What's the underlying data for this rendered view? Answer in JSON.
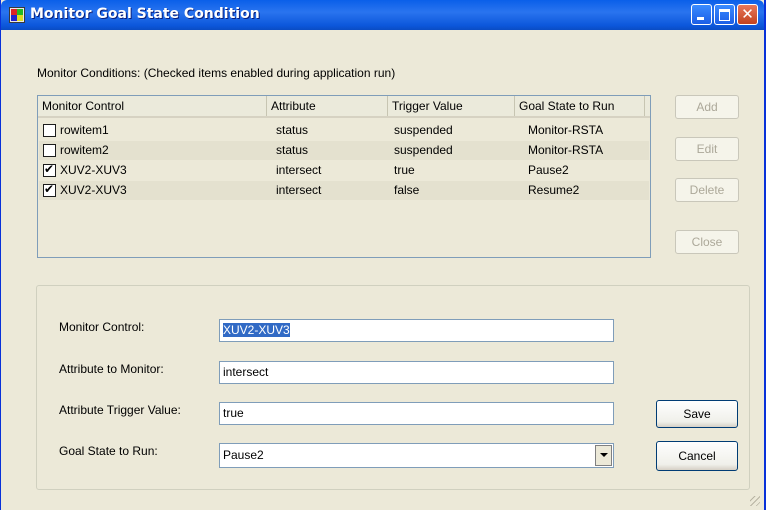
{
  "window": {
    "title": "Monitor Goal State Condition"
  },
  "conditions_label": "Monitor Conditions:  (Checked items enabled during application run)",
  "list": {
    "columns": [
      "Monitor Control",
      "Attribute",
      "Trigger Value",
      "Goal State to Run"
    ],
    "rows": [
      {
        "checked": false,
        "control": "rowitem1",
        "attribute": "status",
        "trigger": "suspended",
        "goal": "Monitor-RSTA"
      },
      {
        "checked": false,
        "control": "rowitem2",
        "attribute": "status",
        "trigger": "suspended",
        "goal": "Monitor-RSTA"
      },
      {
        "checked": true,
        "control": "XUV2-XUV3",
        "attribute": "intersect",
        "trigger": "true",
        "goal": "Pause2"
      },
      {
        "checked": true,
        "control": "XUV2-XUV3",
        "attribute": "intersect",
        "trigger": "false",
        "goal": "Resume2"
      }
    ]
  },
  "side_buttons": {
    "add": "Add",
    "edit": "Edit",
    "delete": "Delete",
    "close": "Close"
  },
  "form": {
    "monitor_control_label": "Monitor Control:",
    "monitor_control_value": "XUV2-XUV3",
    "attribute_label": "Attribute to Monitor:",
    "attribute_value": "intersect",
    "trigger_label": "Attribute Trigger Value:",
    "trigger_value": "true",
    "goal_label": "Goal State to Run:",
    "goal_value": "Pause2"
  },
  "buttons": {
    "save": "Save",
    "cancel": "Cancel"
  }
}
